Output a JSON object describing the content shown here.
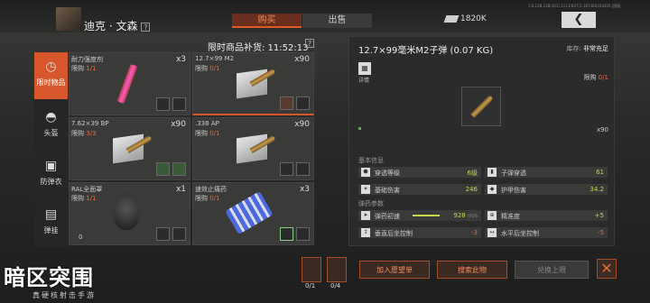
{
  "header": {
    "character_name": "迪克 · 文森",
    "help": "?",
    "tabs": [
      {
        "label": "购买"
      },
      {
        "label": "出售"
      }
    ],
    "cash": "1820K",
    "back_label": "❮",
    "version": "1.0.128.128(161) 1111(837)1.167360354426 |国服"
  },
  "categories": [
    {
      "label": "限时物品",
      "icon": "clock-icon"
    },
    {
      "label": "头盔",
      "icon": "helmet-icon"
    },
    {
      "label": "防弹衣",
      "icon": "vest-icon"
    },
    {
      "label": "弹挂",
      "icon": "rig-icon"
    }
  ],
  "shop": {
    "header": "限时商品补货: 11:52:13",
    "help": "?",
    "items": [
      {
        "name": "耐力强度剂",
        "limit_label": "限购",
        "limit": "1/1",
        "count": "x3"
      },
      {
        "name": "12.7×99 M2",
        "limit_label": "限购",
        "limit": "0/1",
        "count": "x90"
      },
      {
        "name": "7.62×39 BP",
        "limit_label": "限购",
        "limit": "3/3",
        "count": "x90"
      },
      {
        "name": ".338 AP",
        "limit_label": "限购",
        "limit": "0/1",
        "count": "x90"
      },
      {
        "name": "RAL全面罩",
        "limit_label": "限购",
        "limit": "1/1",
        "count": "x1",
        "extra": "0"
      },
      {
        "name": "速效止痛药",
        "limit_label": "限购",
        "limit": "0/1",
        "count": "x3"
      }
    ]
  },
  "detail": {
    "title": "12.7×99毫米M2子弹 (0.07 KG)",
    "stock_label": "库存:",
    "stock_value": "非常充足",
    "detail_label": "详情",
    "limit_label": "限购",
    "limit": "0/1",
    "count": "x90",
    "basic_label": "基本信息",
    "ammo_label": "弹药参数",
    "stats": [
      {
        "label": "穿透等级",
        "value": "6级"
      },
      {
        "label": "子弹穿透",
        "value": "61"
      },
      {
        "label": "基础伤害",
        "value": "246"
      },
      {
        "label": "护甲伤害",
        "value": "34.2"
      }
    ],
    "ammo": [
      {
        "label": "弹药初速",
        "value": "928",
        "unit": "m/s"
      },
      {
        "label": "精准度",
        "value": "+5"
      },
      {
        "label": "垂直后坐控制",
        "value": "-3"
      },
      {
        "label": "水平后坐控制",
        "value": "-5"
      }
    ]
  },
  "footer": {
    "logo": "暗区突围",
    "slogan": "真硬核射击手游",
    "items": [
      {
        "qty": "0/1"
      },
      {
        "qty": "0/4"
      }
    ],
    "buttons": [
      {
        "label": "加入愿望单"
      },
      {
        "label": "搜索此物"
      },
      {
        "label": "兑换上限"
      }
    ],
    "close": "✕"
  }
}
